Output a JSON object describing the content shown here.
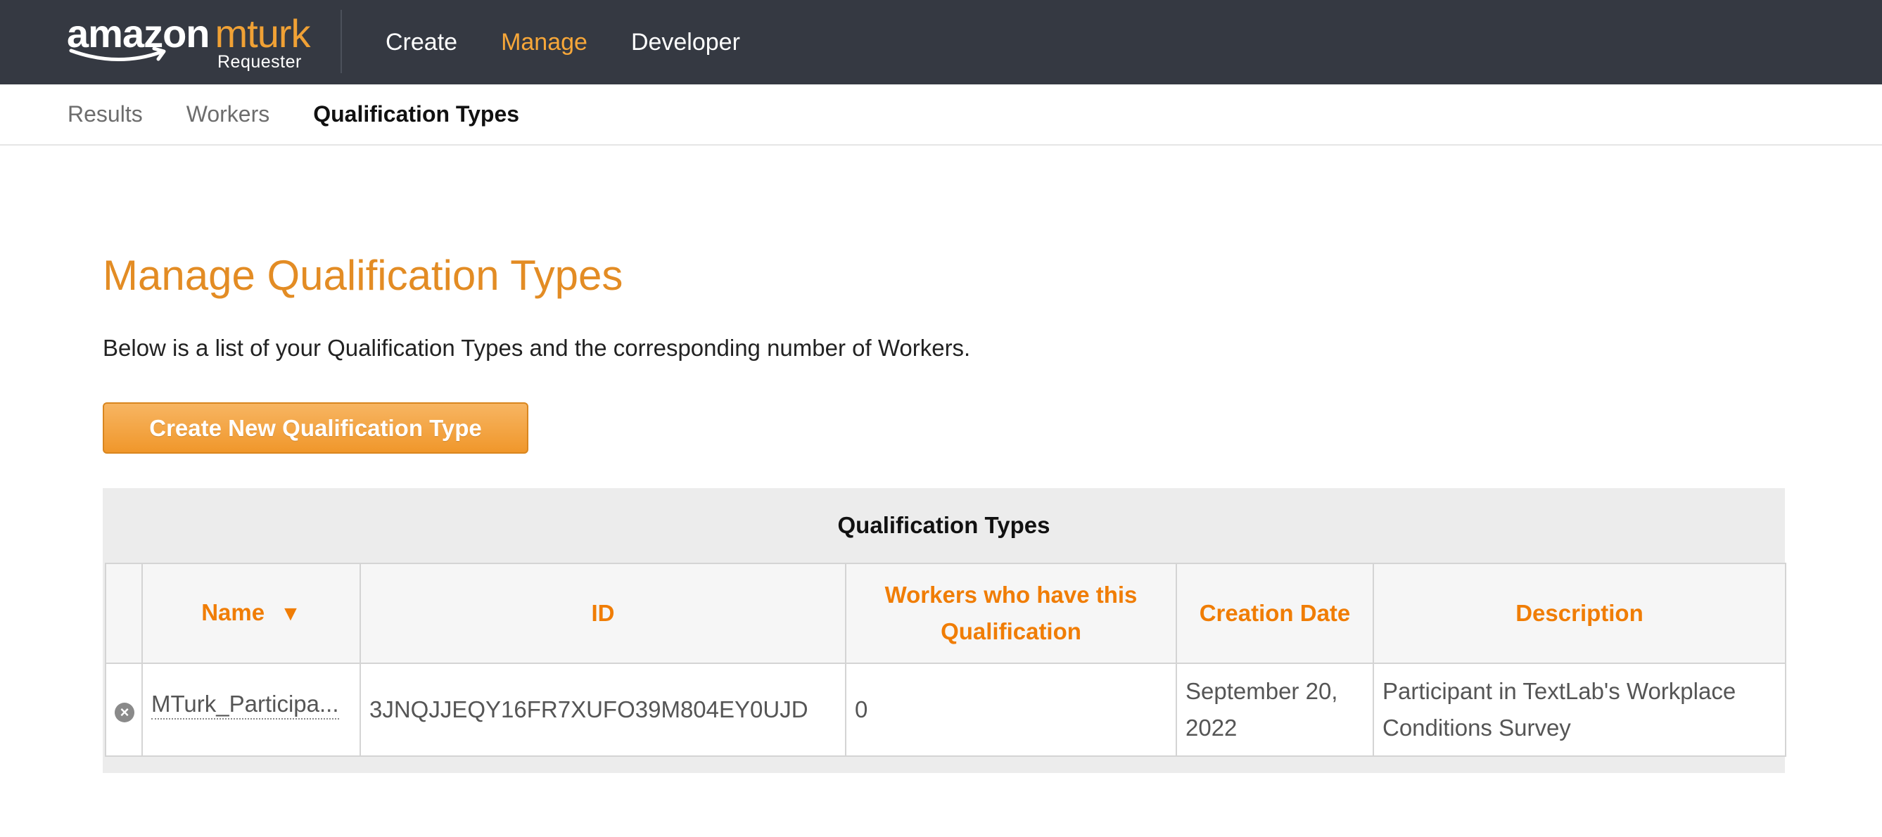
{
  "brand": {
    "amazon": "amazon",
    "mturk": "mturk",
    "requester": "Requester",
    "colors": {
      "header_bg": "#353942",
      "accent": "#f7a739",
      "title": "#e38c24",
      "column_header": "#f07d05"
    }
  },
  "topnav": {
    "items": [
      {
        "label": "Create",
        "active": false
      },
      {
        "label": "Manage",
        "active": true
      },
      {
        "label": "Developer",
        "active": false
      }
    ]
  },
  "subnav": {
    "items": [
      {
        "label": "Results",
        "active": false
      },
      {
        "label": "Workers",
        "active": false
      },
      {
        "label": "Qualification Types",
        "active": true
      }
    ]
  },
  "main": {
    "title": "Manage Qualification Types",
    "intro": "Below is a list of your Qualification Types and the corresponding number of Workers.",
    "create_button": "Create New Qualification Type"
  },
  "table": {
    "caption": "Qualification Types",
    "columns": [
      {
        "label": "Name",
        "sort_icon": "sort-descending-icon"
      },
      {
        "label": "ID"
      },
      {
        "label": "Workers who have this Qualification"
      },
      {
        "label": "Creation Date"
      },
      {
        "label": "Description"
      }
    ],
    "rows": [
      {
        "remove_icon": "remove-icon",
        "name": "MTurk_Participa...",
        "id": "3JNQJJEQY16FR7XUFO39M804EY0UJD",
        "workers": "0",
        "creation_date": "September 20, 2022",
        "description": "Participant in TextLab's Workplace Conditions Survey"
      }
    ]
  }
}
